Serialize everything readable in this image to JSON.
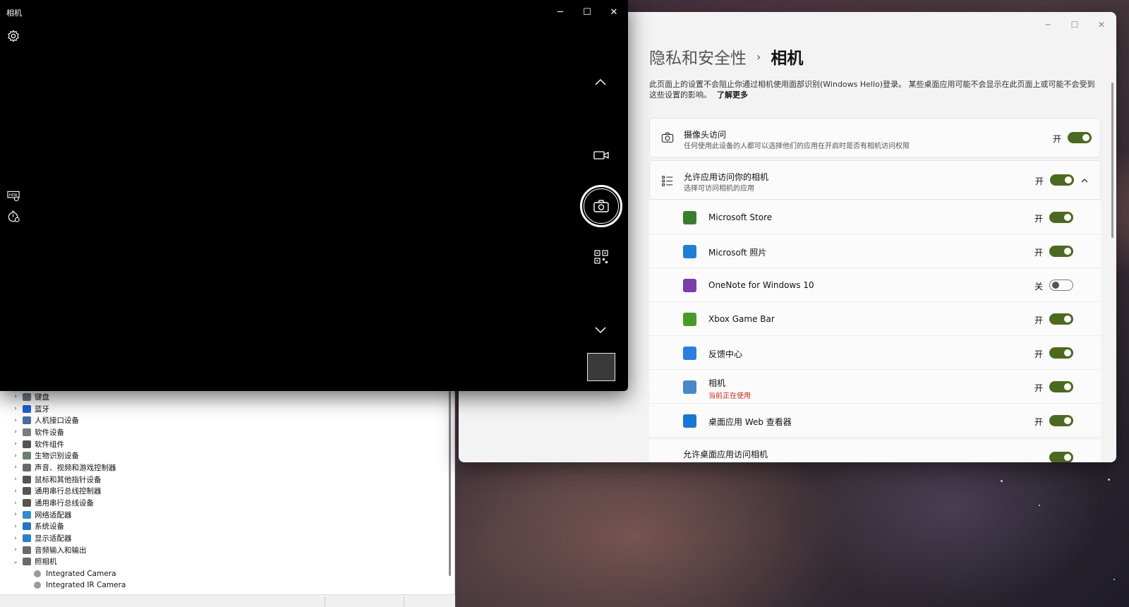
{
  "camera_app": {
    "title": "相机",
    "icons": [
      "settings-icon",
      "chevron-up-icon",
      "video-mode-icon",
      "photo-shutter-icon",
      "qr-scan-icon",
      "chevron-down-icon",
      "hdr-icon",
      "timer-icon"
    ]
  },
  "device_manager": {
    "categories": [
      {
        "label": "键盘",
        "expanded": false
      },
      {
        "label": "蓝牙",
        "expanded": false
      },
      {
        "label": "人机接口设备",
        "expanded": false
      },
      {
        "label": "软件设备",
        "expanded": false
      },
      {
        "label": "软件组件",
        "expanded": false
      },
      {
        "label": "生物识别设备",
        "expanded": false
      },
      {
        "label": "声音、视频和游戏控制器",
        "expanded": false
      },
      {
        "label": "鼠标和其他指针设备",
        "expanded": false
      },
      {
        "label": "通用串行总线控制器",
        "expanded": false
      },
      {
        "label": "通用串行总线设备",
        "expanded": false
      },
      {
        "label": "网络适配器",
        "expanded": false
      },
      {
        "label": "系统设备",
        "expanded": false
      },
      {
        "label": "显示适配器",
        "expanded": false
      },
      {
        "label": "音频输入和输出",
        "expanded": false
      },
      {
        "label": "照相机",
        "expanded": true
      }
    ],
    "camera_children": [
      "Integrated Camera",
      "Integrated IR Camera"
    ]
  },
  "settings": {
    "breadcrumb_parent": "隐私和安全性",
    "breadcrumb_sep": "›",
    "breadcrumb_current": "相机",
    "description": "此页面上的设置不会阻止你通过相机使用面部识别(Windows Hello)登录。 某些桌面应用可能不会显示在此页面上或可能不会受到这些设置的影响。",
    "learn_more": "了解更多",
    "camera_access": {
      "title": "摄像头访问",
      "subtitle": "任何使用此设备的人都可以选择他们的应用在开启时是否有相机访问权限",
      "state": "开",
      "on": true
    },
    "app_access": {
      "title": "允许应用访问你的相机",
      "subtitle": "选择可访问相机的应用",
      "state": "开",
      "on": true
    },
    "apps": [
      {
        "name": "Microsoft Store",
        "state": "开",
        "on": true,
        "color": "#3a7d2c"
      },
      {
        "name": "Microsoft 照片",
        "state": "开",
        "on": true,
        "color": "#1f7fd6"
      },
      {
        "name": "OneNote for Windows 10",
        "state": "关",
        "on": false,
        "color": "#7a3ea8"
      },
      {
        "name": "Xbox Game Bar",
        "state": "开",
        "on": true,
        "color": "#4a9a2a"
      },
      {
        "name": "反馈中心",
        "state": "开",
        "on": true,
        "color": "#2b7fe0"
      },
      {
        "name": "相机",
        "subtitle": "当前正在使用",
        "state": "开",
        "on": true,
        "color": "#4a86c8"
      },
      {
        "name": "桌面应用 Web 查看器",
        "state": "开",
        "on": true,
        "color": "#1976d2"
      }
    ],
    "partial_row": "允许桌面应用访问相机",
    "colors": {
      "toggle_on": "#4b6a1f",
      "in_use_text": "#c42b1c"
    }
  }
}
